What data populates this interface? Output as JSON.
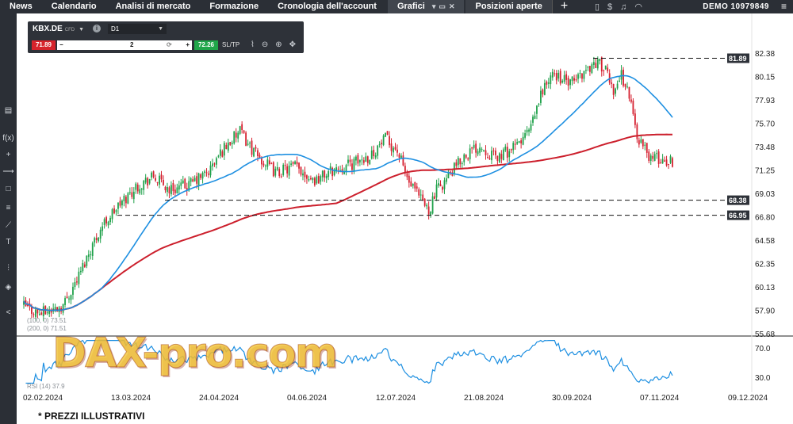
{
  "topbar": {
    "items": [
      "News",
      "Calendario",
      "Analisi di mercato",
      "Formazione",
      "Cronologia dell'account"
    ],
    "tab_active": "Grafici",
    "tab_other": "Posizioni aperte",
    "plus": "+",
    "account": "DEMO  10979849",
    "menu": "≡"
  },
  "instrument": {
    "symbol": "KBX.DE",
    "type": "CFD",
    "timeframe": "D1",
    "sell": "71.89",
    "quantity": "2",
    "buy": "72.26",
    "sltp": "SL/TP",
    "minus": "−",
    "plus": "+"
  },
  "indicator_labels": {
    "ma_legend": "(100, 0) 73.51",
    "ma_legend2": "(200, 0) 71.51",
    "rsi": "RSI (14) 37.9"
  },
  "watermark": "DAX-pro.com",
  "footer": "* PREZZI ILLUSTRATIVI",
  "colors": {
    "up": "#1fa14a",
    "down": "#d62030",
    "ma_fast": "#1d8fe1",
    "ma_slow": "#cc1f2c",
    "rsi": "#1d8fe1"
  },
  "chart_data": {
    "type": "line",
    "title": "KBX.DE CFD D1",
    "price_axis_ticks": [
      "82.38",
      "80.15",
      "77.93",
      "75.70",
      "73.48",
      "71.25",
      "69.03",
      "66.80",
      "64.58",
      "62.35",
      "60.13",
      "57.90",
      "55.68"
    ],
    "date_axis_ticks": [
      "02.02.2024",
      "13.03.2024",
      "24.04.2024",
      "04.06.2024",
      "12.07.2024",
      "21.08.2024",
      "30.09.2024",
      "07.11.2024",
      "09.12.2024"
    ],
    "ylim": [
      55.68,
      82.38
    ],
    "price_levels": [
      "81.89",
      "68.38",
      "66.95"
    ],
    "rsi_ticks": [
      "70.0",
      "30.0"
    ],
    "series": [
      {
        "name": "KBX.DE",
        "x": [
          "02.02.2024",
          "13.03.2024",
          "24.04.2024",
          "04.06.2024",
          "12.07.2024",
          "21.08.2024",
          "30.09.2024",
          "07.11.2024"
        ],
        "values": [
          58.2,
          69.9,
          71.0,
          71.6,
          69.4,
          72.5,
          80.3,
          72.3
        ]
      },
      {
        "name": "MA 100",
        "x": [
          "02.02.2024",
          "13.03.2024",
          "24.04.2024",
          "04.06.2024",
          "12.07.2024",
          "21.08.2024",
          "30.09.2024",
          "07.11.2024"
        ],
        "values": [
          58.1,
          61.9,
          67.7,
          70.8,
          71.9,
          71.8,
          75.4,
          77.4
        ]
      },
      {
        "name": "MA 200",
        "x": [
          "02.02.2024",
          "13.03.2024",
          "24.04.2024",
          "04.06.2024",
          "12.07.2024",
          "21.08.2024",
          "30.09.2024",
          "07.11.2024"
        ],
        "values": [
          58.5,
          60.8,
          63.4,
          65.5,
          66.8,
          68.6,
          70.2,
          71.9
        ]
      },
      {
        "name": "RSI (14)",
        "x": [
          "02.02.2024",
          "13.03.2024",
          "24.04.2024",
          "04.06.2024",
          "12.07.2024",
          "21.08.2024",
          "30.09.2024",
          "07.11.2024"
        ],
        "values": [
          50,
          62,
          55,
          52,
          45,
          58,
          65,
          37.9
        ]
      }
    ]
  }
}
